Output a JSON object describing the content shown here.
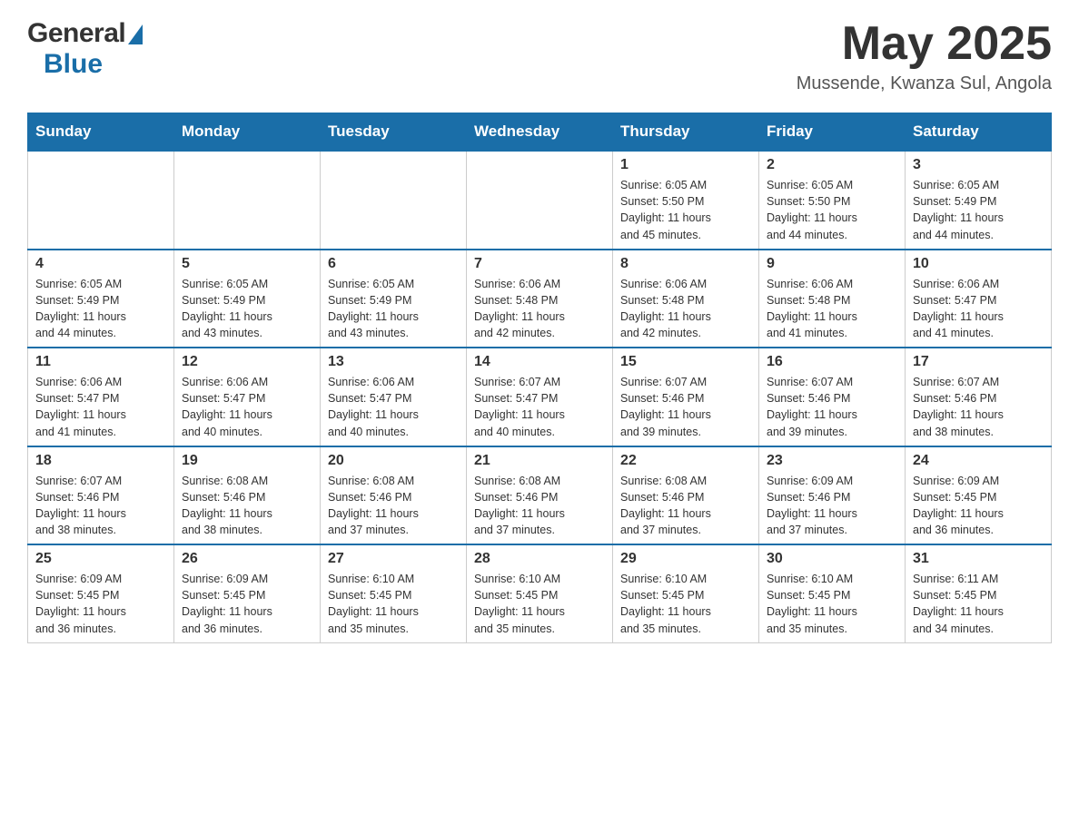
{
  "header": {
    "logo_general": "General",
    "logo_blue": "Blue",
    "month_year": "May 2025",
    "location": "Mussende, Kwanza Sul, Angola"
  },
  "days_of_week": [
    "Sunday",
    "Monday",
    "Tuesday",
    "Wednesday",
    "Thursday",
    "Friday",
    "Saturday"
  ],
  "weeks": [
    [
      {
        "day": "",
        "info": ""
      },
      {
        "day": "",
        "info": ""
      },
      {
        "day": "",
        "info": ""
      },
      {
        "day": "",
        "info": ""
      },
      {
        "day": "1",
        "info": "Sunrise: 6:05 AM\nSunset: 5:50 PM\nDaylight: 11 hours\nand 45 minutes."
      },
      {
        "day": "2",
        "info": "Sunrise: 6:05 AM\nSunset: 5:50 PM\nDaylight: 11 hours\nand 44 minutes."
      },
      {
        "day": "3",
        "info": "Sunrise: 6:05 AM\nSunset: 5:49 PM\nDaylight: 11 hours\nand 44 minutes."
      }
    ],
    [
      {
        "day": "4",
        "info": "Sunrise: 6:05 AM\nSunset: 5:49 PM\nDaylight: 11 hours\nand 44 minutes."
      },
      {
        "day": "5",
        "info": "Sunrise: 6:05 AM\nSunset: 5:49 PM\nDaylight: 11 hours\nand 43 minutes."
      },
      {
        "day": "6",
        "info": "Sunrise: 6:05 AM\nSunset: 5:49 PM\nDaylight: 11 hours\nand 43 minutes."
      },
      {
        "day": "7",
        "info": "Sunrise: 6:06 AM\nSunset: 5:48 PM\nDaylight: 11 hours\nand 42 minutes."
      },
      {
        "day": "8",
        "info": "Sunrise: 6:06 AM\nSunset: 5:48 PM\nDaylight: 11 hours\nand 42 minutes."
      },
      {
        "day": "9",
        "info": "Sunrise: 6:06 AM\nSunset: 5:48 PM\nDaylight: 11 hours\nand 41 minutes."
      },
      {
        "day": "10",
        "info": "Sunrise: 6:06 AM\nSunset: 5:47 PM\nDaylight: 11 hours\nand 41 minutes."
      }
    ],
    [
      {
        "day": "11",
        "info": "Sunrise: 6:06 AM\nSunset: 5:47 PM\nDaylight: 11 hours\nand 41 minutes."
      },
      {
        "day": "12",
        "info": "Sunrise: 6:06 AM\nSunset: 5:47 PM\nDaylight: 11 hours\nand 40 minutes."
      },
      {
        "day": "13",
        "info": "Sunrise: 6:06 AM\nSunset: 5:47 PM\nDaylight: 11 hours\nand 40 minutes."
      },
      {
        "day": "14",
        "info": "Sunrise: 6:07 AM\nSunset: 5:47 PM\nDaylight: 11 hours\nand 40 minutes."
      },
      {
        "day": "15",
        "info": "Sunrise: 6:07 AM\nSunset: 5:46 PM\nDaylight: 11 hours\nand 39 minutes."
      },
      {
        "day": "16",
        "info": "Sunrise: 6:07 AM\nSunset: 5:46 PM\nDaylight: 11 hours\nand 39 minutes."
      },
      {
        "day": "17",
        "info": "Sunrise: 6:07 AM\nSunset: 5:46 PM\nDaylight: 11 hours\nand 38 minutes."
      }
    ],
    [
      {
        "day": "18",
        "info": "Sunrise: 6:07 AM\nSunset: 5:46 PM\nDaylight: 11 hours\nand 38 minutes."
      },
      {
        "day": "19",
        "info": "Sunrise: 6:08 AM\nSunset: 5:46 PM\nDaylight: 11 hours\nand 38 minutes."
      },
      {
        "day": "20",
        "info": "Sunrise: 6:08 AM\nSunset: 5:46 PM\nDaylight: 11 hours\nand 37 minutes."
      },
      {
        "day": "21",
        "info": "Sunrise: 6:08 AM\nSunset: 5:46 PM\nDaylight: 11 hours\nand 37 minutes."
      },
      {
        "day": "22",
        "info": "Sunrise: 6:08 AM\nSunset: 5:46 PM\nDaylight: 11 hours\nand 37 minutes."
      },
      {
        "day": "23",
        "info": "Sunrise: 6:09 AM\nSunset: 5:46 PM\nDaylight: 11 hours\nand 37 minutes."
      },
      {
        "day": "24",
        "info": "Sunrise: 6:09 AM\nSunset: 5:45 PM\nDaylight: 11 hours\nand 36 minutes."
      }
    ],
    [
      {
        "day": "25",
        "info": "Sunrise: 6:09 AM\nSunset: 5:45 PM\nDaylight: 11 hours\nand 36 minutes."
      },
      {
        "day": "26",
        "info": "Sunrise: 6:09 AM\nSunset: 5:45 PM\nDaylight: 11 hours\nand 36 minutes."
      },
      {
        "day": "27",
        "info": "Sunrise: 6:10 AM\nSunset: 5:45 PM\nDaylight: 11 hours\nand 35 minutes."
      },
      {
        "day": "28",
        "info": "Sunrise: 6:10 AM\nSunset: 5:45 PM\nDaylight: 11 hours\nand 35 minutes."
      },
      {
        "day": "29",
        "info": "Sunrise: 6:10 AM\nSunset: 5:45 PM\nDaylight: 11 hours\nand 35 minutes."
      },
      {
        "day": "30",
        "info": "Sunrise: 6:10 AM\nSunset: 5:45 PM\nDaylight: 11 hours\nand 35 minutes."
      },
      {
        "day": "31",
        "info": "Sunrise: 6:11 AM\nSunset: 5:45 PM\nDaylight: 11 hours\nand 34 minutes."
      }
    ]
  ]
}
